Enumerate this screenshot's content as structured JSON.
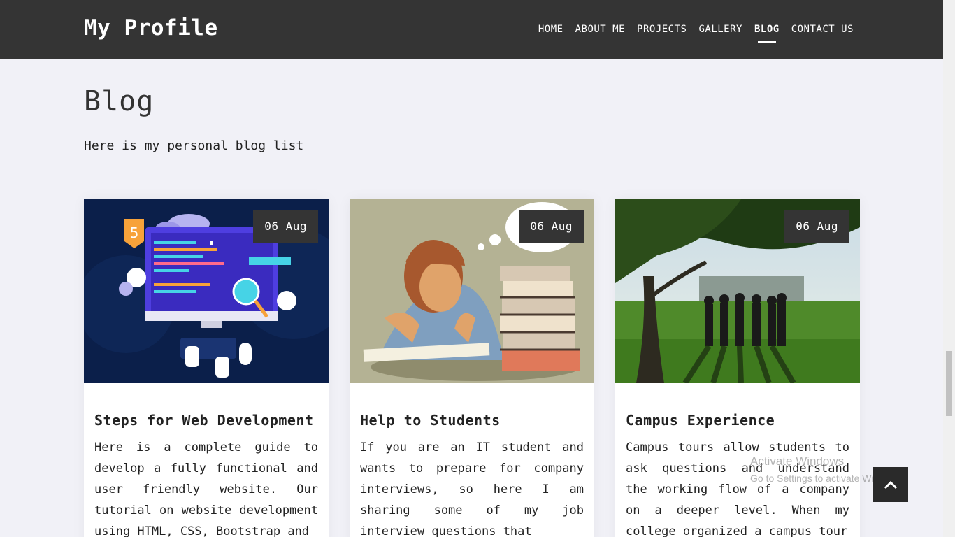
{
  "header": {
    "brand": "My Profile",
    "nav": [
      {
        "label": "HOME"
      },
      {
        "label": "ABOUT ME"
      },
      {
        "label": "PROJECTS"
      },
      {
        "label": "GALLERY"
      },
      {
        "label": "BLOG",
        "active": true
      },
      {
        "label": "CONTACT US"
      }
    ]
  },
  "main": {
    "title": "Blog",
    "subtitle": "Here is my personal blog list",
    "posts": [
      {
        "date": "06 Aug",
        "title": "Steps for Web Development",
        "excerpt": "Here is a complete guide to develop a fully functional and user friendly website. Our tutorial on website development using HTML, CSS, Bootstrap and",
        "image": "web-development-illustration"
      },
      {
        "date": "06 Aug",
        "title": "Help to Students",
        "excerpt": "If you are an IT student and wants to prepare for company interviews, so here I am sharing some of my job interview questions that",
        "image": "stressed-student-illustration"
      },
      {
        "date": "06 Aug",
        "title": "Campus Experience",
        "excerpt": "Campus tours allow students to ask questions and understand the working flow of a company on a deeper level. When my college organized a campus tour",
        "image": "campus-photo"
      }
    ]
  },
  "scroll_top": {
    "icon": "chevron-up-icon"
  },
  "watermark": {
    "line1": "Activate Windows",
    "line2": "Go to Settings to activate Windows."
  },
  "colors": {
    "navbar": "#343434",
    "page_bg": "#f1f1f7",
    "badge": "#343434"
  }
}
